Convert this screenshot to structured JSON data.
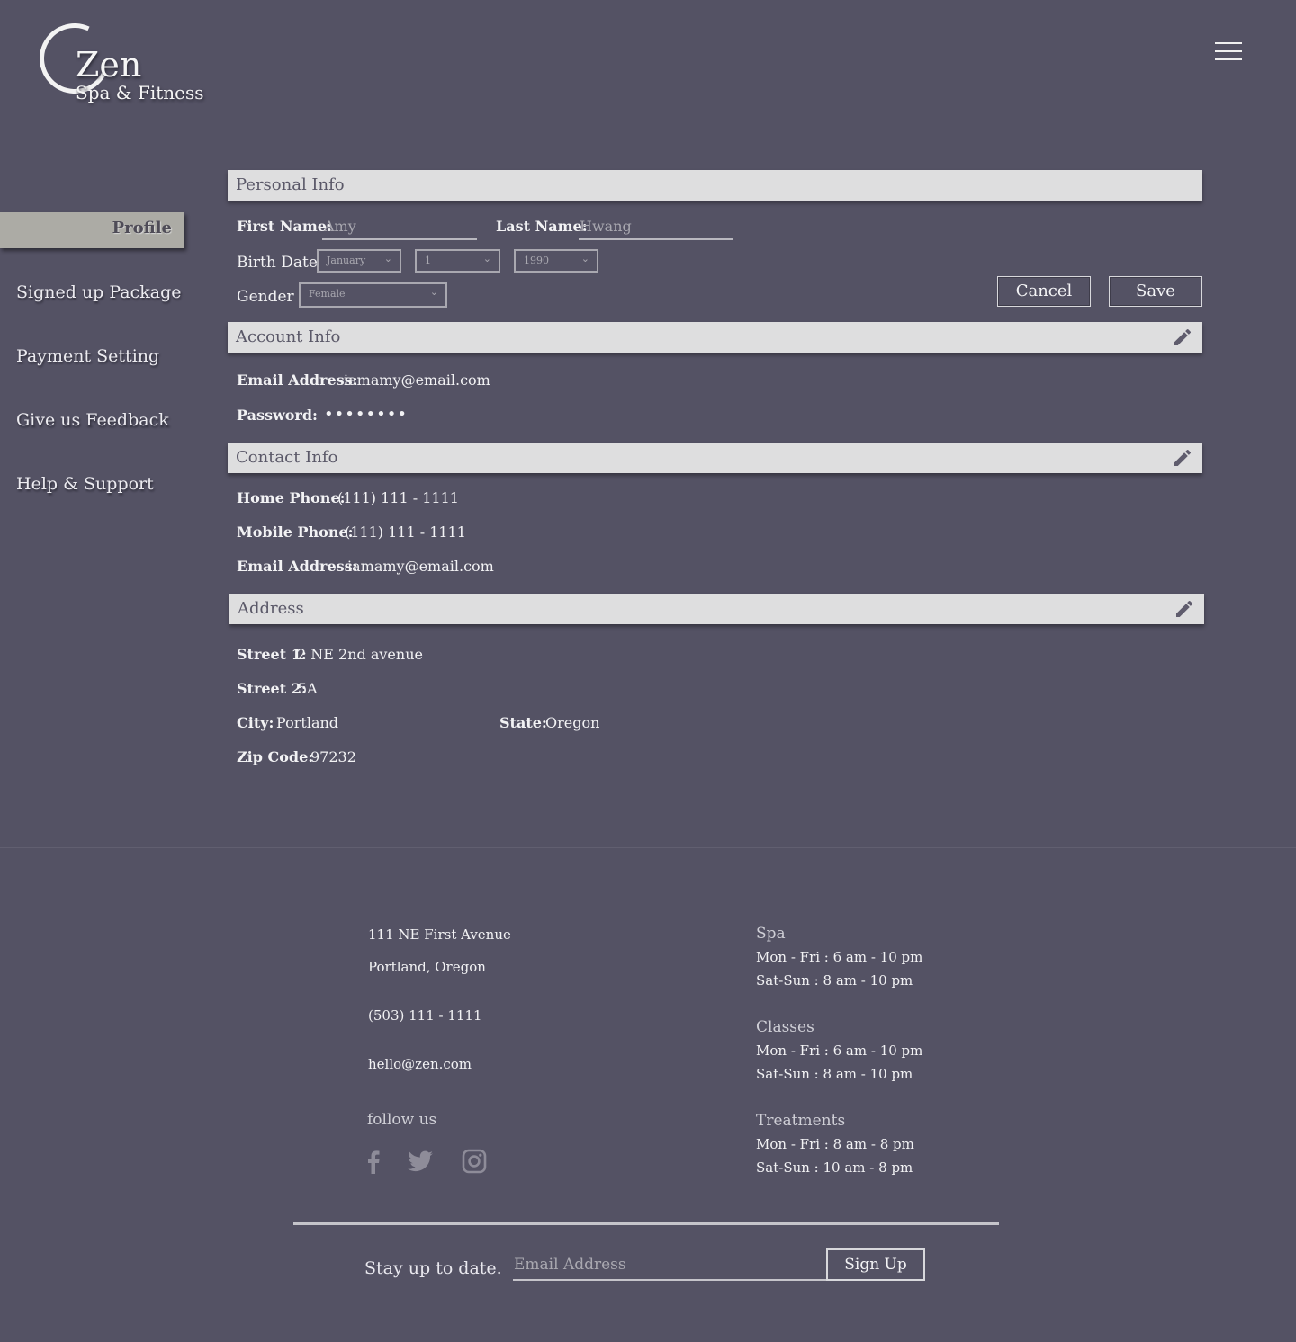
{
  "brand": {
    "name": "Zen",
    "tagline": "Spa & Fitness"
  },
  "sidebar": {
    "items": [
      {
        "label": "Profile"
      },
      {
        "label": "Signed up Package"
      },
      {
        "label": "Payment Setting"
      },
      {
        "label": "Give us Feedback"
      },
      {
        "label": "Help & Support"
      }
    ]
  },
  "personal": {
    "title": "Personal Info",
    "first_name_label": "First Name:",
    "first_name": "Amy",
    "last_name_label": "Last Name:",
    "last_name": "Hwang",
    "birth_label": "Birth Date",
    "birth_month": "January",
    "birth_day": "1",
    "birth_year": "1990",
    "gender_label": "Gender",
    "gender": "Female",
    "cancel": "Cancel",
    "save": "Save"
  },
  "account": {
    "title": "Account Info",
    "email_label": "Email Address:",
    "email": "iamamy@email.com",
    "password_label": "Password:",
    "password": "••••••••"
  },
  "contact": {
    "title": "Contact Info",
    "home_label": "Home Phone:",
    "home": "(111) 111 - 1111",
    "mobile_label": "Mobile Phone:",
    "mobile": "(111) 111 - 1111",
    "email_label": "Email Address:",
    "email": "iamamy@email.com"
  },
  "address": {
    "title": "Address",
    "street1_label": "Street 1:",
    "street1": "2 NE 2nd avenue",
    "street2_label": "Street 2:",
    "street2": "5A",
    "city_label": "City:",
    "city": "Portland",
    "state_label": "State:",
    "state": "Oregon",
    "zip_label": "Zip Code:",
    "zip": "97232"
  },
  "footer": {
    "street": "111 NE First Avenue",
    "city": "Portland, Oregon",
    "phone": "(503) 111 - 1111",
    "email": "hello@zen.com",
    "follow": "follow us",
    "hours": [
      {
        "name": "Spa",
        "weekday": "Mon - Fri :  6 am - 10 pm",
        "weekend": "Sat-Sun : 8 am - 10 pm"
      },
      {
        "name": "Classes",
        "weekday": "Mon - Fri :  6 am - 10 pm",
        "weekend": "Sat-Sun :  8 am - 10 pm"
      },
      {
        "name": "Treatments",
        "weekday": "Mon - Fri :  8 am - 8 pm",
        "weekend": "Sat-Sun :  10 am - 8 pm"
      }
    ],
    "newsletter_label": "Stay up to date.",
    "newsletter_placeholder": "Email Address",
    "signup": "Sign Up"
  },
  "icons": [
    "menu-icon",
    "edit-icon",
    "facebook-icon",
    "twitter-icon",
    "instagram-icon"
  ]
}
